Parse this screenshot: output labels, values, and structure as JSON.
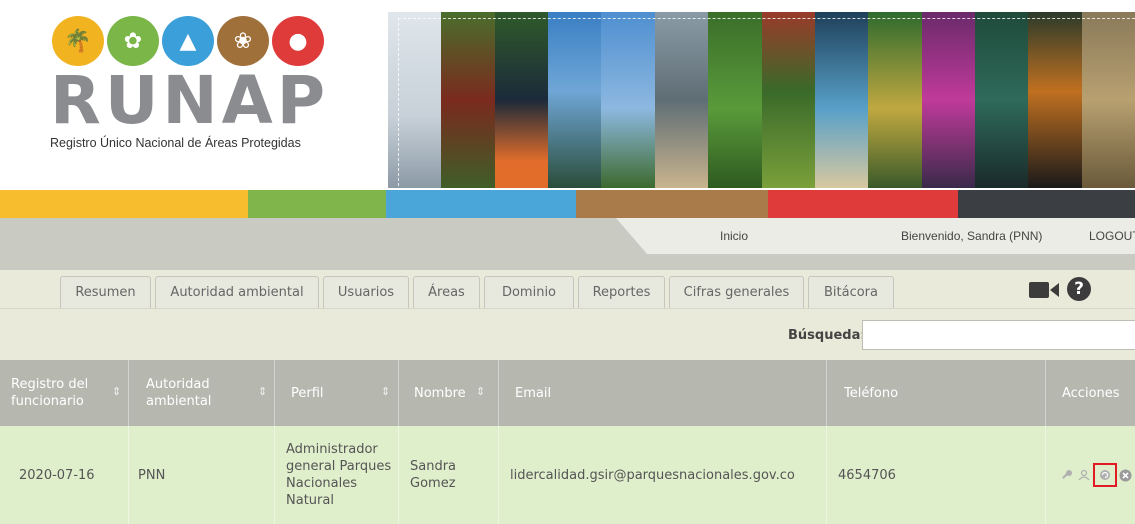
{
  "header": {
    "logo_word": "RUNAP",
    "logo_subtitle": "Registro Único Nacional de Áreas Protegidas",
    "logo_icon_colors": [
      "#f2b321",
      "#7ab648",
      "#3b9fd9",
      "#a0703a",
      "#e03b3b"
    ]
  },
  "colors": {
    "bar": [
      "#f7bd2e",
      "#7fb54a",
      "#4aa6d9",
      "#a97b4a",
      "#e03b3b",
      "#3b3f44"
    ]
  },
  "nav": {
    "home": "Inicio",
    "welcome": "Bienvenido, Sandra (PNN)",
    "logout": "LOGOUT"
  },
  "tabs": [
    "Resumen",
    "Autoridad ambiental",
    "Usuarios",
    "Áreas",
    "Dominio",
    "Reportes",
    "Cifras generales",
    "Bitácora"
  ],
  "toolbar": {
    "video_icon": "video-camera-icon",
    "help_icon": "question-circle-icon",
    "help_glyph": "?"
  },
  "search": {
    "label": "Búsqueda:",
    "value": ""
  },
  "table": {
    "headers": [
      "Registro del funcionario",
      "Autoridad ambiental",
      "Perfil",
      "Nombre",
      "Email",
      "Teléfono",
      "Acciones"
    ],
    "rows": [
      {
        "date": "2020-07-16",
        "authority": "PNN",
        "profile": "Administrador general Parques Nacionales Natural",
        "name": "Sandra Gomez",
        "email": "lidercalidad.gsir@parquesnacionales.gov.co",
        "phone": "4654706",
        "actions": [
          "key-icon",
          "user-icon",
          "reset-icon",
          "delete-icon"
        ]
      }
    ]
  }
}
